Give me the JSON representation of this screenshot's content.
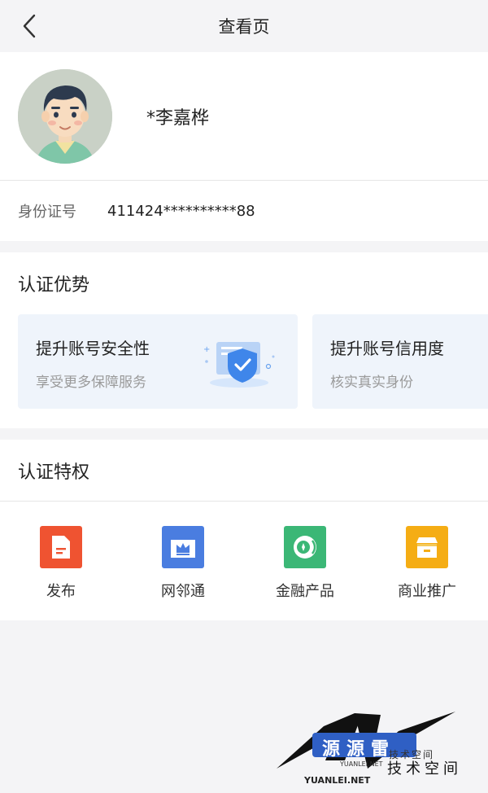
{
  "nav": {
    "title": "查看页"
  },
  "profile": {
    "name": "*李嘉桦"
  },
  "id_card": {
    "label": "身份证号",
    "value": "411424**********88"
  },
  "advantages": {
    "title": "认证优势",
    "cards": [
      {
        "title": "提升账号安全性",
        "subtitle": "享受更多保障服务",
        "icon": "security-shield-illustration"
      },
      {
        "title": "提升账号信用度",
        "subtitle": "核实真实身份"
      }
    ]
  },
  "privileges": {
    "title": "认证特权",
    "items": [
      {
        "label": "发布",
        "icon": "publish-icon",
        "color": "#ef5331"
      },
      {
        "label": "网邻通",
        "icon": "crown-icon",
        "color": "#4a7de0"
      },
      {
        "label": "金融产品",
        "icon": "coin-icon",
        "color": "#3bb776"
      },
      {
        "label": "商业推广",
        "icon": "store-icon",
        "color": "#f5ad14"
      }
    ]
  },
  "watermark": {
    "logo_text": "源源雷",
    "tagline": "技术空间",
    "brand": "YUANLEI.NET",
    "small_text": "YUANLEI.NET",
    "small_tagline": "技术空间"
  }
}
